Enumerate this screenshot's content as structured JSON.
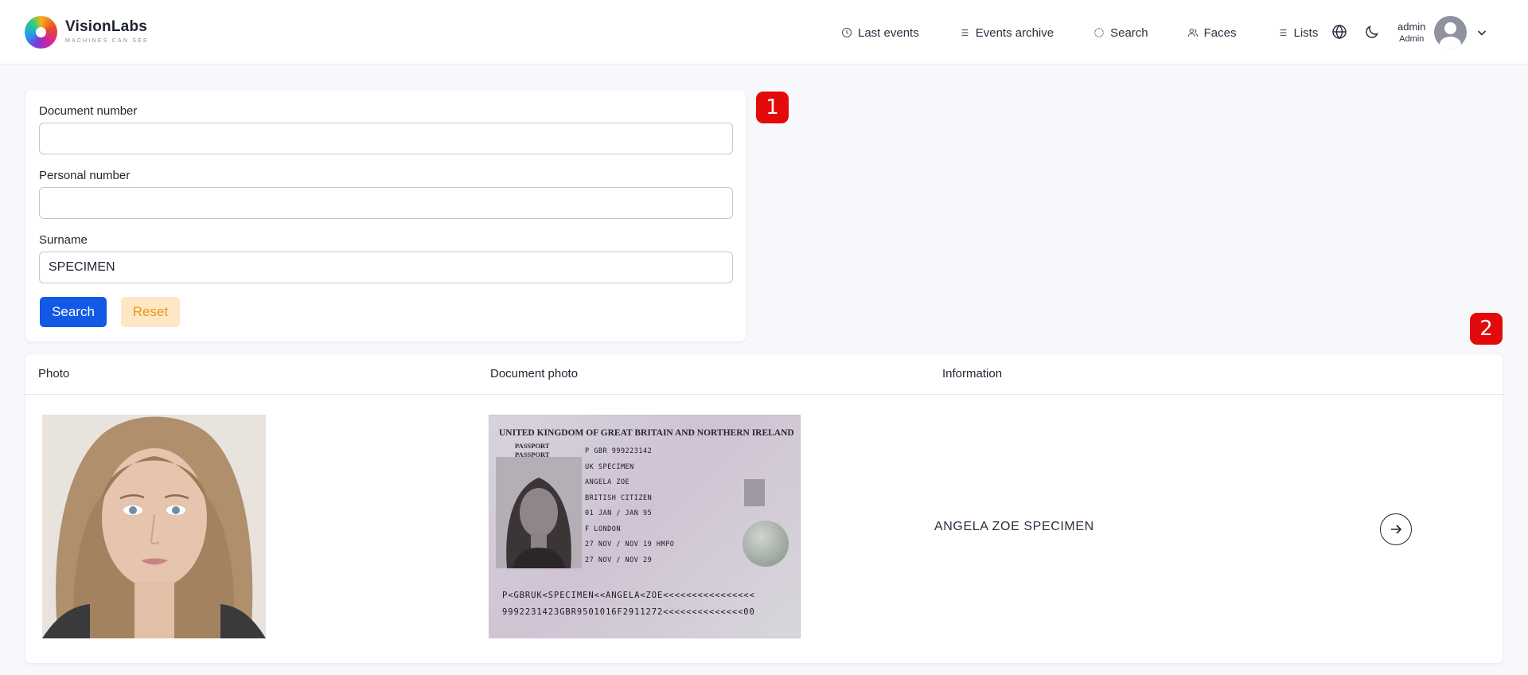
{
  "app": {
    "brand_name": "VisionLabs",
    "brand_tagline": "MACHINES CAN SEE"
  },
  "nav": {
    "items": [
      {
        "label": "Last events",
        "icon": "clock-icon"
      },
      {
        "label": "Events archive",
        "icon": "list-icon"
      },
      {
        "label": "Search",
        "icon": "search-target-icon"
      },
      {
        "label": "Faces",
        "icon": "users-icon"
      },
      {
        "label": "Lists",
        "icon": "list-icon"
      }
    ],
    "language_icon": "globe-icon",
    "theme_icon": "moon-icon"
  },
  "user": {
    "name": "admin",
    "role": "Admin"
  },
  "form": {
    "document_number_label": "Document number",
    "document_number_value": "",
    "personal_number_label": "Personal number",
    "personal_number_value": "",
    "surname_label": "Surname",
    "surname_value": "SPECIMEN",
    "search_label": "Search",
    "reset_label": "Reset"
  },
  "badges": {
    "first": "1",
    "second": "2"
  },
  "results": {
    "columns": [
      "Photo",
      "Document photo",
      "Information"
    ],
    "rows": [
      {
        "information": "ANGELA ZOE SPECIMEN",
        "document": {
          "title": "UNITED KINGDOM OF GREAT BRITAIN AND NORTHERN IRELAND",
          "type_line_1": "PASSPORT",
          "type_line_2": "PASSPORT",
          "field_type": "P          GBR           999223142",
          "surname": "UK SPECIMEN",
          "given_names": "ANGELA ZOE",
          "nationality": "BRITISH CITIZEN",
          "dob": "01 JAN / JAN 95",
          "sex_place": "F      LONDON",
          "issue": "27 NOV / NOV 19  HMPO",
          "expiry": "27 NOV / NOV 29",
          "mrz_1": "P<GBRUK<SPECIMEN<<ANGELA<ZOE<<<<<<<<<<<<<<<<",
          "mrz_2": "9992231423GBR9501016F2911272<<<<<<<<<<<<<<00"
        }
      }
    ]
  },
  "colors": {
    "primary": "#1259e6",
    "reset_bg": "#fde8c5",
    "reset_text": "#e89518",
    "badge": "#e20a0a"
  }
}
